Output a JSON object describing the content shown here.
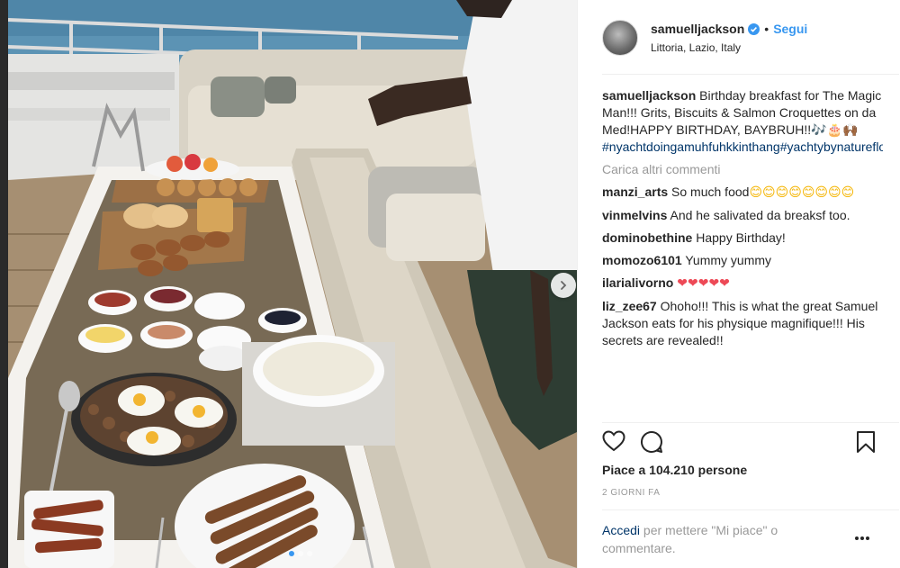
{
  "post": {
    "username": "samuelljackson",
    "follow_label": "Segui",
    "separator": "•",
    "location": "Littoria, Lazio, Italy",
    "caption_user": "samuelljackson",
    "caption_text": "Birthday breakfast for The Magic Man!!! Grits, Biscuits & Salmon Croquettes on da Med!HAPPY BIRTHDAY, BAYBRUH!!🎶🎂🙌🏾",
    "hashtags": "#nyachtdoingamuhfuhkkinthang#yachtybynaturefloatingcookout",
    "load_more": "Carica altri commenti",
    "likes": "Piace a 104.210 persone",
    "time": "2 GIORNI FA"
  },
  "comments": [
    {
      "user": "manzi_arts",
      "text": "So much food",
      "emoji": "😊😊😊😊😊😊😊😊"
    },
    {
      "user": "vinmelvins",
      "text": "And he salivated da breaksf too.",
      "emoji": ""
    },
    {
      "user": "dominobethine",
      "text": "Happy Birthday!",
      "emoji": ""
    },
    {
      "user": "momozo6101",
      "text": "Yummy yummy",
      "emoji": ""
    },
    {
      "user": "ilarialivorno",
      "text": "",
      "emoji": "❤❤❤❤❤"
    },
    {
      "user": "liz_zee67",
      "text": "Ohoho!!! This is what the great Samuel Jackson eats for his physique magnifique!!! His secrets are revealed!!",
      "emoji": ""
    }
  ],
  "footer": {
    "login_link": "Accedi",
    "login_text": " per mettere \"Mi piace\" o commentare."
  },
  "carousel": {
    "dot_count": 3,
    "active_dot": 1
  },
  "icons": {
    "verified": "verified-badge-icon",
    "like": "heart-outline-icon",
    "comment": "comment-bubble-icon",
    "save": "bookmark-icon",
    "next": "chevron-right-icon",
    "more": "more-options-icon"
  },
  "colors": {
    "link_blue": "#3897f0",
    "hashtag_blue": "#003569",
    "muted": "#999999",
    "heart_red": "#ed4956"
  }
}
